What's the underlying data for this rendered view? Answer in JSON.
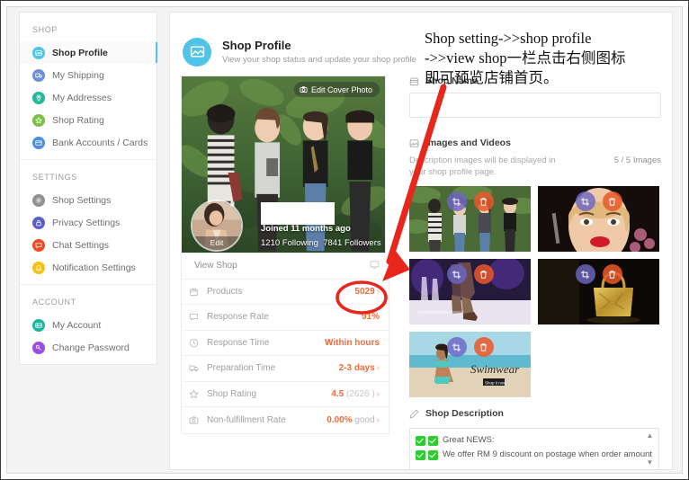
{
  "sidebar": {
    "groups": [
      {
        "title": "SHOP",
        "items": [
          {
            "label": "Shop Profile",
            "icon": "image-icon",
            "color": "#4fc3e8",
            "active": true
          },
          {
            "label": "My Shipping",
            "icon": "truck-icon",
            "color": "#6e8fd8",
            "active": false
          },
          {
            "label": "My Addresses",
            "icon": "location-pin-icon",
            "color": "#22b99a",
            "active": false
          },
          {
            "label": "Shop Rating",
            "icon": "star-icon",
            "color": "#7cc043",
            "active": false
          },
          {
            "label": "Bank Accounts / Cards",
            "icon": "bank-card-icon",
            "color": "#4a8fe0",
            "active": false
          }
        ]
      },
      {
        "title": "SETTINGS",
        "items": [
          {
            "label": "Shop Settings",
            "icon": "gear-icon",
            "color": "#8f9193",
            "active": false
          },
          {
            "label": "Privacy Settings",
            "icon": "lock-icon",
            "color": "#5a5fc7",
            "active": false
          },
          {
            "label": "Chat Settings",
            "icon": "chat-icon",
            "color": "#ef4b23",
            "active": false
          },
          {
            "label": "Notification Settings",
            "icon": "bell-icon",
            "color": "#f6c211",
            "active": false
          }
        ]
      },
      {
        "title": "ACCOUNT",
        "items": [
          {
            "label": "My Account",
            "icon": "user-card-icon",
            "color": "#1ab6a0",
            "active": false
          },
          {
            "label": "Change Password",
            "icon": "key-icon",
            "color": "#9b4fe0",
            "active": false
          }
        ]
      }
    ]
  },
  "header": {
    "icon": "image-icon",
    "title": "Shop Profile",
    "subtitle": "View your shop status and update your shop profile",
    "accent": "#4fc3e8"
  },
  "profile": {
    "edit_cover_label": "Edit Cover Photo",
    "edit_cover_icon": "camera-icon",
    "avatar_edit_label": "Edit",
    "joined": "Joined 11 months ago",
    "following": "1210 Following",
    "followers": "7841 Followers"
  },
  "stats": {
    "view_shop": {
      "label": "View Shop",
      "icon": "monitor-icon"
    },
    "rows": [
      {
        "label": "Products",
        "icon": "bag-icon",
        "value": "5029",
        "suffix": "",
        "chevron": true
      },
      {
        "label": "Response Rate",
        "icon": "chat-icon",
        "value": "91%",
        "suffix": "",
        "chevron": false
      },
      {
        "label": "Response Time",
        "icon": "clock-icon",
        "value": "Within hours",
        "suffix": "",
        "chevron": false
      },
      {
        "label": "Preparation Time",
        "icon": "truck-icon",
        "value": "2-3 days",
        "suffix": "",
        "chevron": true
      },
      {
        "label": "Shop Rating",
        "icon": "star-icon",
        "value": "4.5",
        "suffix": "(2626 )",
        "chevron": true
      },
      {
        "label": "Non-fulfillment Rate",
        "icon": "camera-icon",
        "value": "0.00%",
        "suffix": "good",
        "chevron": true
      }
    ],
    "accent": "#ef6c3a"
  },
  "shop_name": {
    "label": "Shop Name",
    "icon": "store-icon",
    "value": "",
    "placeholder": ""
  },
  "images_videos": {
    "label": "Images and Videos",
    "icon": "picture-icon",
    "description": "Description images will be displayed in your shop profile page.",
    "count": "5 / 5 Images",
    "crop_icon": "crop-icon",
    "delete_icon": "trash-icon",
    "thumbnails": [
      {
        "alt": "four women outdoors in greenery",
        "theme": "greenery"
      },
      {
        "alt": "blonde woman with red lipstick portrait",
        "theme": "portrait"
      },
      {
        "alt": "runway fashion legs and heels",
        "theme": "runway"
      },
      {
        "alt": "gold handbag on dark background",
        "theme": "handbag"
      },
      {
        "alt": "woman in swimwear on beach",
        "theme": "swimwear",
        "caption": "Swimwear"
      }
    ]
  },
  "shop_description": {
    "label": "Shop Description",
    "icon": "pencil-icon",
    "lines": [
      "Great NEWS:",
      "We offer RM 9 discount on postage when order amount"
    ],
    "scroll_up": "▲",
    "scroll_down": "▼"
  },
  "annotation": {
    "lines": [
      "Shop setting->>shop profile",
      "->>view shop一栏点击右侧图标",
      "即可预览店铺首页。"
    ],
    "color": "#e8261c"
  }
}
